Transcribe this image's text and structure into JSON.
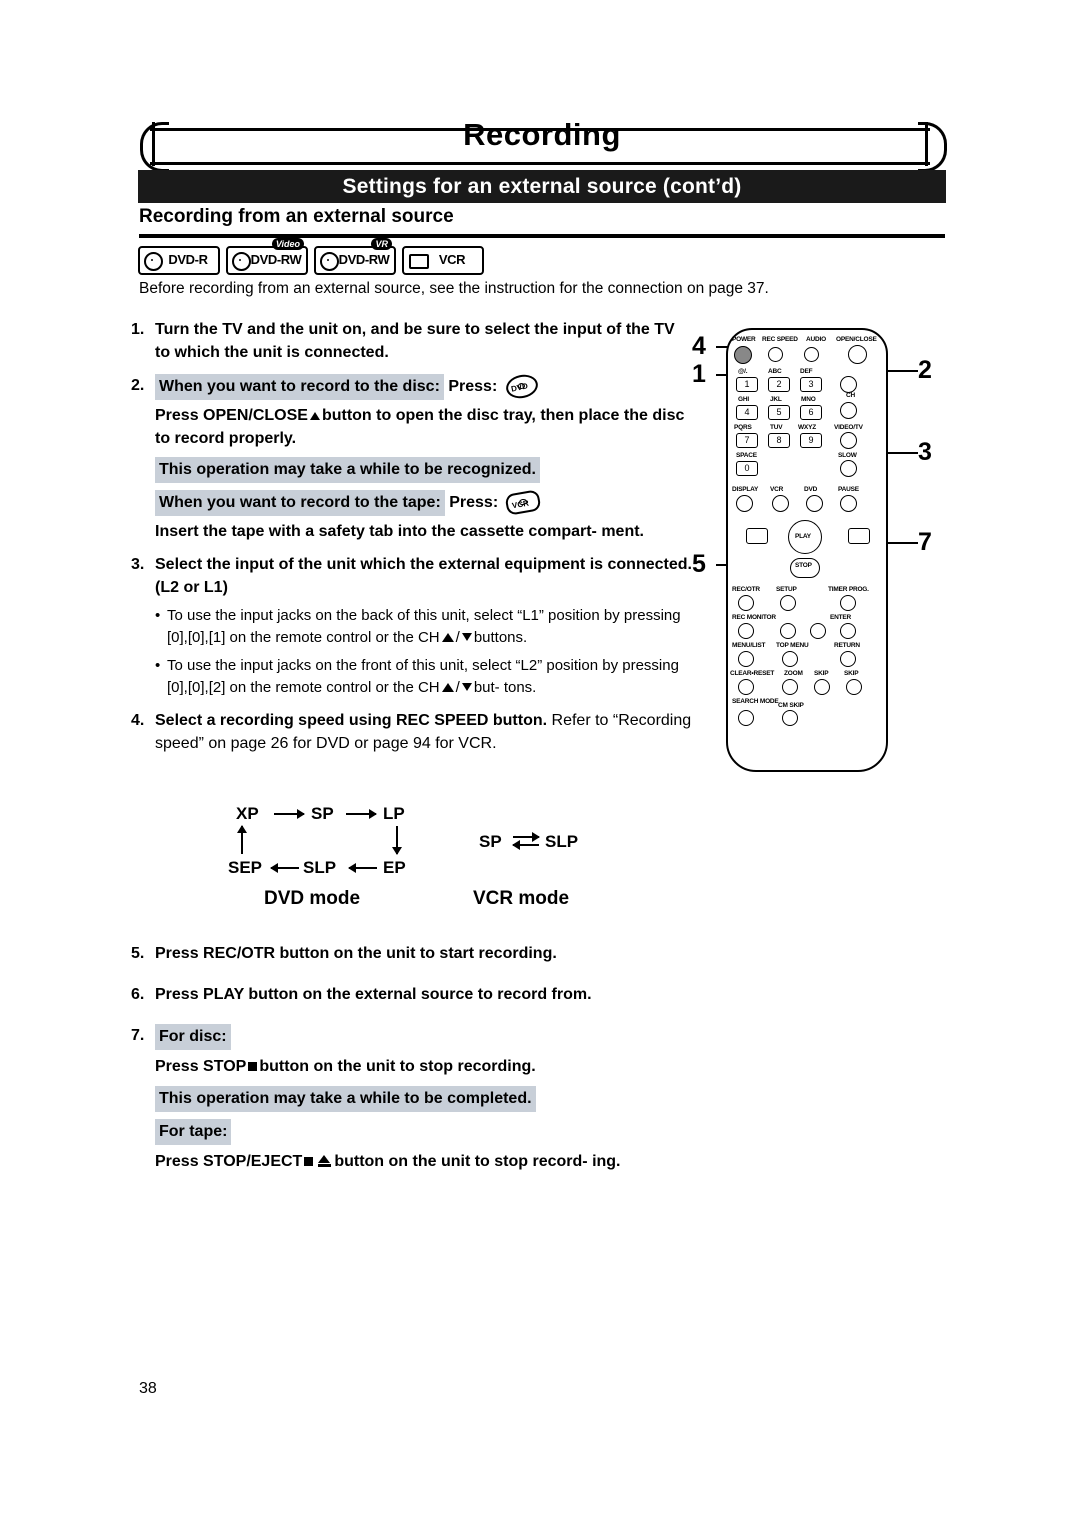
{
  "header": {
    "title": "Recording",
    "subtitle": "Settings for an external source (cont’d)",
    "section": "Recording from an external source"
  },
  "badges": [
    {
      "name": "DVD-R",
      "tag": ""
    },
    {
      "name": "DVD-RW",
      "tag": "Video"
    },
    {
      "name": "DVD-RW",
      "tag": "VR"
    },
    {
      "name": "VCR",
      "tag": ""
    }
  ],
  "intro": "Before recording from an external source, see the instruction for the connection on page 37.",
  "steps": {
    "s1_num": "1.",
    "s1_text": "Turn the TV and the unit on, and be sure to select the input of the TV to which the unit is connected.",
    "s2_num": "2.",
    "s2_disc_lead": "When you want to record to the disc:",
    "s2_press": "Press:",
    "s2_open": "Press OPEN/CLOSE",
    "s2_open_rest": "button to open the disc tray, then place the disc to record properly.",
    "s2_highlight": "This operation may take a while to be recognized.",
    "s2_tape_lead": "When you want to record to the tape:",
    "s2_tape_press": "Press:",
    "s2_tape_text": "Insert the tape with a safety tab into the cassette compart- ment.",
    "s3_num": "3.",
    "s3_text": "Select the input of the unit which the external equipment is connected. (L2 or L1)",
    "s3_b1": "To use the input jacks on the back of this unit, select “L1” position by pressing [0],[0],[1] on the remote control or the CH",
    "s3_b1_end": "buttons.",
    "s3_b2": "To use the input jacks on the front of this unit, select “L2” position by pressing [0],[0],[2] on the remote control or the CH",
    "s3_b2_end": "but- tons.",
    "s4_num": "4.",
    "s4_bold": "Select a recording speed using REC SPEED button.",
    "s4_rest": "Refer to “Recording speed” on page 26 for DVD or page 94 for VCR.",
    "s5_num": "5.",
    "s5_text": "Press REC/OTR button on the unit to start recording.",
    "s6_num": "6.",
    "s6_text": "Press PLAY button on the external source to record from.",
    "s7_num": "7.",
    "s7_disc_label": "For disc:",
    "s7_disc_text_a": "Press STOP",
    "s7_disc_text_b": "button on the unit to stop recording.",
    "s7_highlight": "This operation may take a while to be completed.",
    "s7_tape_label": "For tape:",
    "s7_tape_a": "Press STOP/EJECT",
    "s7_tape_b": "button on the unit to stop record- ing."
  },
  "speed_diagram": {
    "dvd": {
      "xp": "XP",
      "sp": "SP",
      "lp": "LP",
      "ep": "EP",
      "slp": "SLP",
      "sep": "SEP",
      "label": "DVD mode"
    },
    "vcr": {
      "sp": "SP",
      "slp": "SLP",
      "label": "VCR mode"
    }
  },
  "remote": {
    "callouts": {
      "c1": "1",
      "c2": "2",
      "c3": "3",
      "c4": "4",
      "c5": "5",
      "c7": "7"
    },
    "labels": {
      "power": "POWER",
      "rec_speed": "REC SPEED",
      "audio": "AUDIO",
      "open_close": "OPEN/CLOSE",
      "k1": "@/.",
      "k2": "ABC",
      "k3": "DEF",
      "k4": "GHI",
      "k5": "JKL",
      "k6": "MNO",
      "k7": "PQRS",
      "k8": "TUV",
      "k9": "WXYZ",
      "k0": "SPACE",
      "ch": "CH",
      "video_tv": "VIDEO/TV",
      "display": "DISPLAY",
      "vcr": "VCR",
      "dvd": "DVD",
      "pause": "PAUSE",
      "slow": "SLOW",
      "play": "PLAY",
      "stop": "STOP",
      "rec_otr": "REC/OTR",
      "setup": "SETUP",
      "timer_prog": "TIMER PROG.",
      "rec_monitor": "REC MONITOR",
      "enter": "ENTER",
      "menu_list": "MENU/LIST",
      "top_menu": "TOP MENU",
      "return": "RETURN",
      "clear_reset": "CLEAR•RESET",
      "zoom": "ZOOM",
      "skip_back": "SKIP",
      "skip_fwd": "SKIP",
      "search_mode": "SEARCH MODE",
      "cm_skip": "CM SKIP"
    }
  },
  "page_number": "38"
}
